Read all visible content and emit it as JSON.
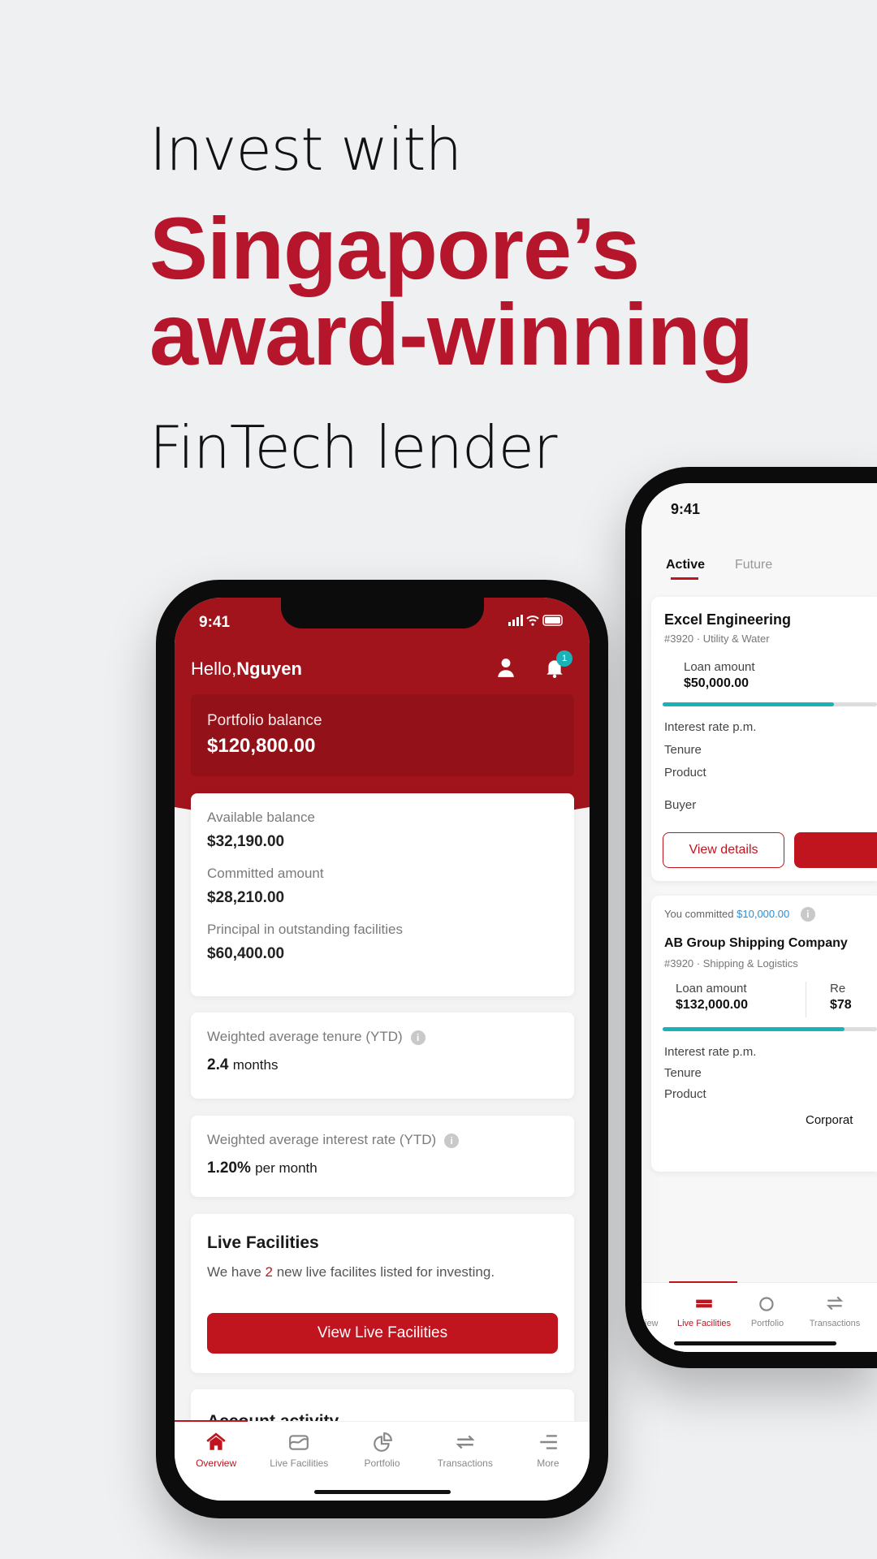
{
  "headline": {
    "line1": "Invest with",
    "line2": "Singapore’s",
    "line3": "award-winning",
    "line4": "FinTech lender"
  },
  "colors": {
    "brand_red": "#b5162b",
    "app_red": "#a1141b",
    "button_red": "#c0141e",
    "teal": "#1ab2b8"
  },
  "phone_main": {
    "status_time": "9:41",
    "greeting": "Hello,",
    "user_name": "Nguyen",
    "icons": [
      "user-icon",
      "bell-icon"
    ],
    "notification_count": "1",
    "portfolio": {
      "label": "Portfolio balance",
      "value": "$120,800.00"
    },
    "balances": [
      {
        "label": "Available balance",
        "value": "$32,190.00"
      },
      {
        "label": "Committed amount",
        "value": "$28,210.00"
      },
      {
        "label": "Principal in outstanding facilities",
        "value": "$60,400.00"
      }
    ],
    "tenure": {
      "label": "Weighted average tenure (YTD)",
      "value": "2.4",
      "unit": "months"
    },
    "interest": {
      "label": "Weighted average interest rate (YTD)",
      "value": "1.20%",
      "unit": "per month"
    },
    "live": {
      "title": "Live Facilities",
      "text_pre": "We have",
      "count": "2",
      "text_post": "new live facilites listed for investing.",
      "button": "View Live Facilities"
    },
    "account_activity": "Account activity",
    "tabs": [
      {
        "label": "Overview",
        "icon": "home-icon",
        "active": true
      },
      {
        "label": "Live Facilities",
        "icon": "chart-area-icon"
      },
      {
        "label": "Portfolio",
        "icon": "pie-chart-icon"
      },
      {
        "label": "Transactions",
        "icon": "swap-icon"
      },
      {
        "label": "More",
        "icon": "menu-icon"
      }
    ]
  },
  "phone_second": {
    "status_time": "9:41",
    "tabs": [
      "Active",
      "Future"
    ],
    "card1": {
      "name": "Excel Engineering",
      "id": "#3920",
      "sector": "Utility & Water",
      "loan_label": "Loan amount",
      "loan_value": "$50,000.00",
      "progress": 0.8,
      "rows": [
        "Interest rate p.m.",
        "Tenure",
        "Product",
        "Buyer"
      ],
      "button": "View details"
    },
    "card2": {
      "committed_label": "You committed",
      "committed_value": "$10,000.00",
      "name": "AB Group Shipping Company",
      "id": "#3920",
      "sector": "Shipping & Logistics",
      "loan_label": "Loan amount",
      "loan_value": "$132,000.00",
      "right_label": "Re",
      "right_value": "$78",
      "progress": 0.85,
      "rows": [
        "Interest rate p.m.",
        "Tenure",
        "Product"
      ],
      "extra": "Corporat"
    },
    "tabbar": [
      {
        "label": "iew"
      },
      {
        "label": "Live Facilities",
        "active": true
      },
      {
        "label": "Portfolio"
      },
      {
        "label": "Transactions"
      }
    ]
  }
}
